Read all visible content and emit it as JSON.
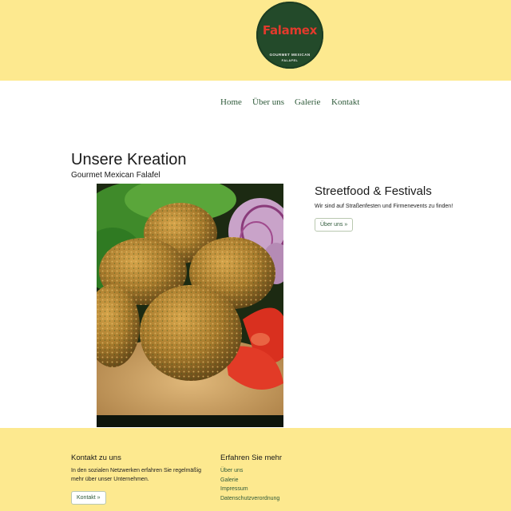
{
  "logo": {
    "name": "Falamex",
    "line1": "GOURMET MEXICAN",
    "line2": "FALAFEL",
    "color_bg": "#234a2a",
    "color_text": "#e23a2c"
  },
  "nav": {
    "items": [
      "Home",
      "Über uns",
      "Galerie",
      "Kontakt"
    ]
  },
  "main": {
    "title": "Unsere Kreation",
    "subtitle": "Gourmet Mexican Falafel"
  },
  "aside": {
    "title": "Streetfood & Festivals",
    "text": "Wir sind auf Straßenfesten und Firmenevents zu finden!",
    "button": "Über uns »"
  },
  "footer": {
    "contact": {
      "heading": "Kontakt zu uns",
      "text": "In den sozialen Netzwerken erfahren Sie regelmäßig mehr über unser Unternehmen.",
      "button": "Kontakt »"
    },
    "more": {
      "heading": "Erfahren Sie mehr",
      "links": [
        "Über uns",
        "Galerie",
        "Impressum",
        "Datenschutzverordnung"
      ]
    }
  },
  "colors": {
    "band": "#fde98f",
    "link": "#2f5a3a"
  }
}
